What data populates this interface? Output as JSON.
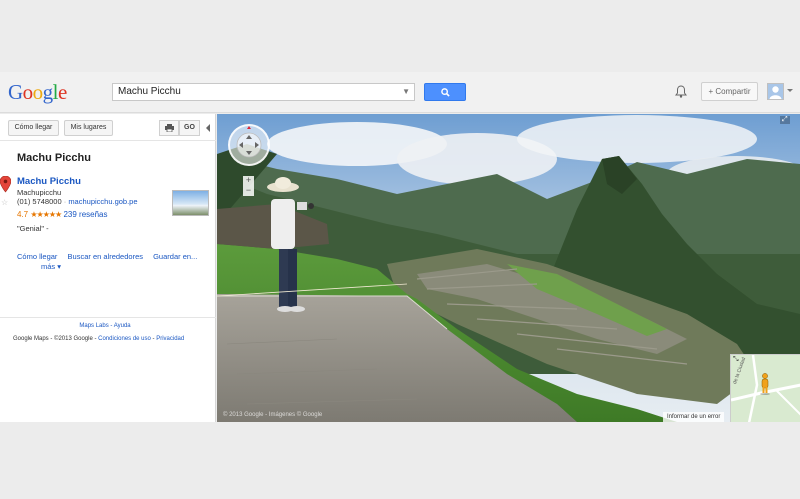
{
  "header": {
    "logo_letters": [
      "G",
      "o",
      "o",
      "g",
      "l",
      "e"
    ],
    "logo_colors": [
      "#3366cc",
      "#dd3322",
      "#eeaa11",
      "#3366cc",
      "#22aa44",
      "#dd3322"
    ],
    "search_value": "Machu Picchu",
    "share_label": "+ Compartir"
  },
  "toolbar": {
    "directions_label": "Cómo llegar",
    "my_places_label": "Mis lugares",
    "link_label": "GO"
  },
  "place": {
    "title": "Machu Picchu",
    "result_name": "Machu Picchu",
    "locality": "Machupicchu",
    "phone": "(01) 5748000",
    "separator": "·",
    "website": "machupicchu.gob.pe",
    "rating": "4.7",
    "stars": "★★★★★",
    "reviews": "239 reseñas",
    "quote": "\"Genial\" -",
    "actions": [
      "Cómo llegar",
      "Buscar en alrededores",
      "Guardar en..."
    ],
    "more": "más ▾"
  },
  "footer": {
    "links": "Maps Labs - Ayuda",
    "copyright_prefix": "Google Maps - ©2013 Google - ",
    "terms": "Condiciones de uso",
    "privacy": "Privacidad"
  },
  "streetview": {
    "report_label": "Informar de un error",
    "copyright": "© 2013 Google - Imágenes © Google",
    "fullscreen_label": "⤢",
    "zoom_in": "+",
    "zoom_out": "−",
    "minimap_label": "⤡",
    "minimap_street": "de la Ciudad"
  },
  "colors": {
    "accent_blue": "#4d90fe",
    "link_blue": "#1a57c2",
    "rating_orange": "#e67600"
  }
}
